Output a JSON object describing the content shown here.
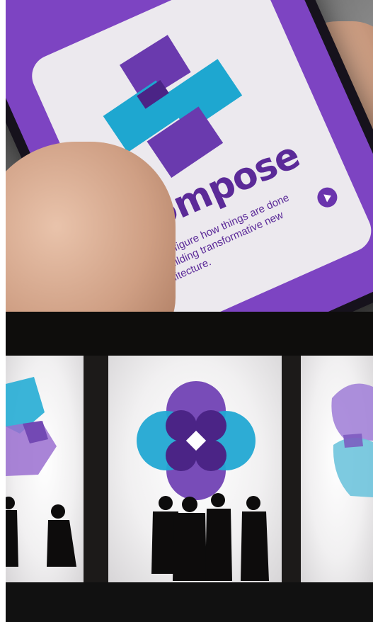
{
  "phone_screen": {
    "brand_name": "Compose",
    "tagline": "Reconfigure how things are done by building transformative new architecture."
  },
  "colors": {
    "brand_purple": "#7d44c2",
    "deep_purple": "#5b2a98",
    "cyan": "#1ea7d0",
    "card_bg": "#ece9ee",
    "dark_purple": "#4b2486"
  },
  "icons": {
    "play": "play-icon",
    "logo": "compose-logo"
  }
}
